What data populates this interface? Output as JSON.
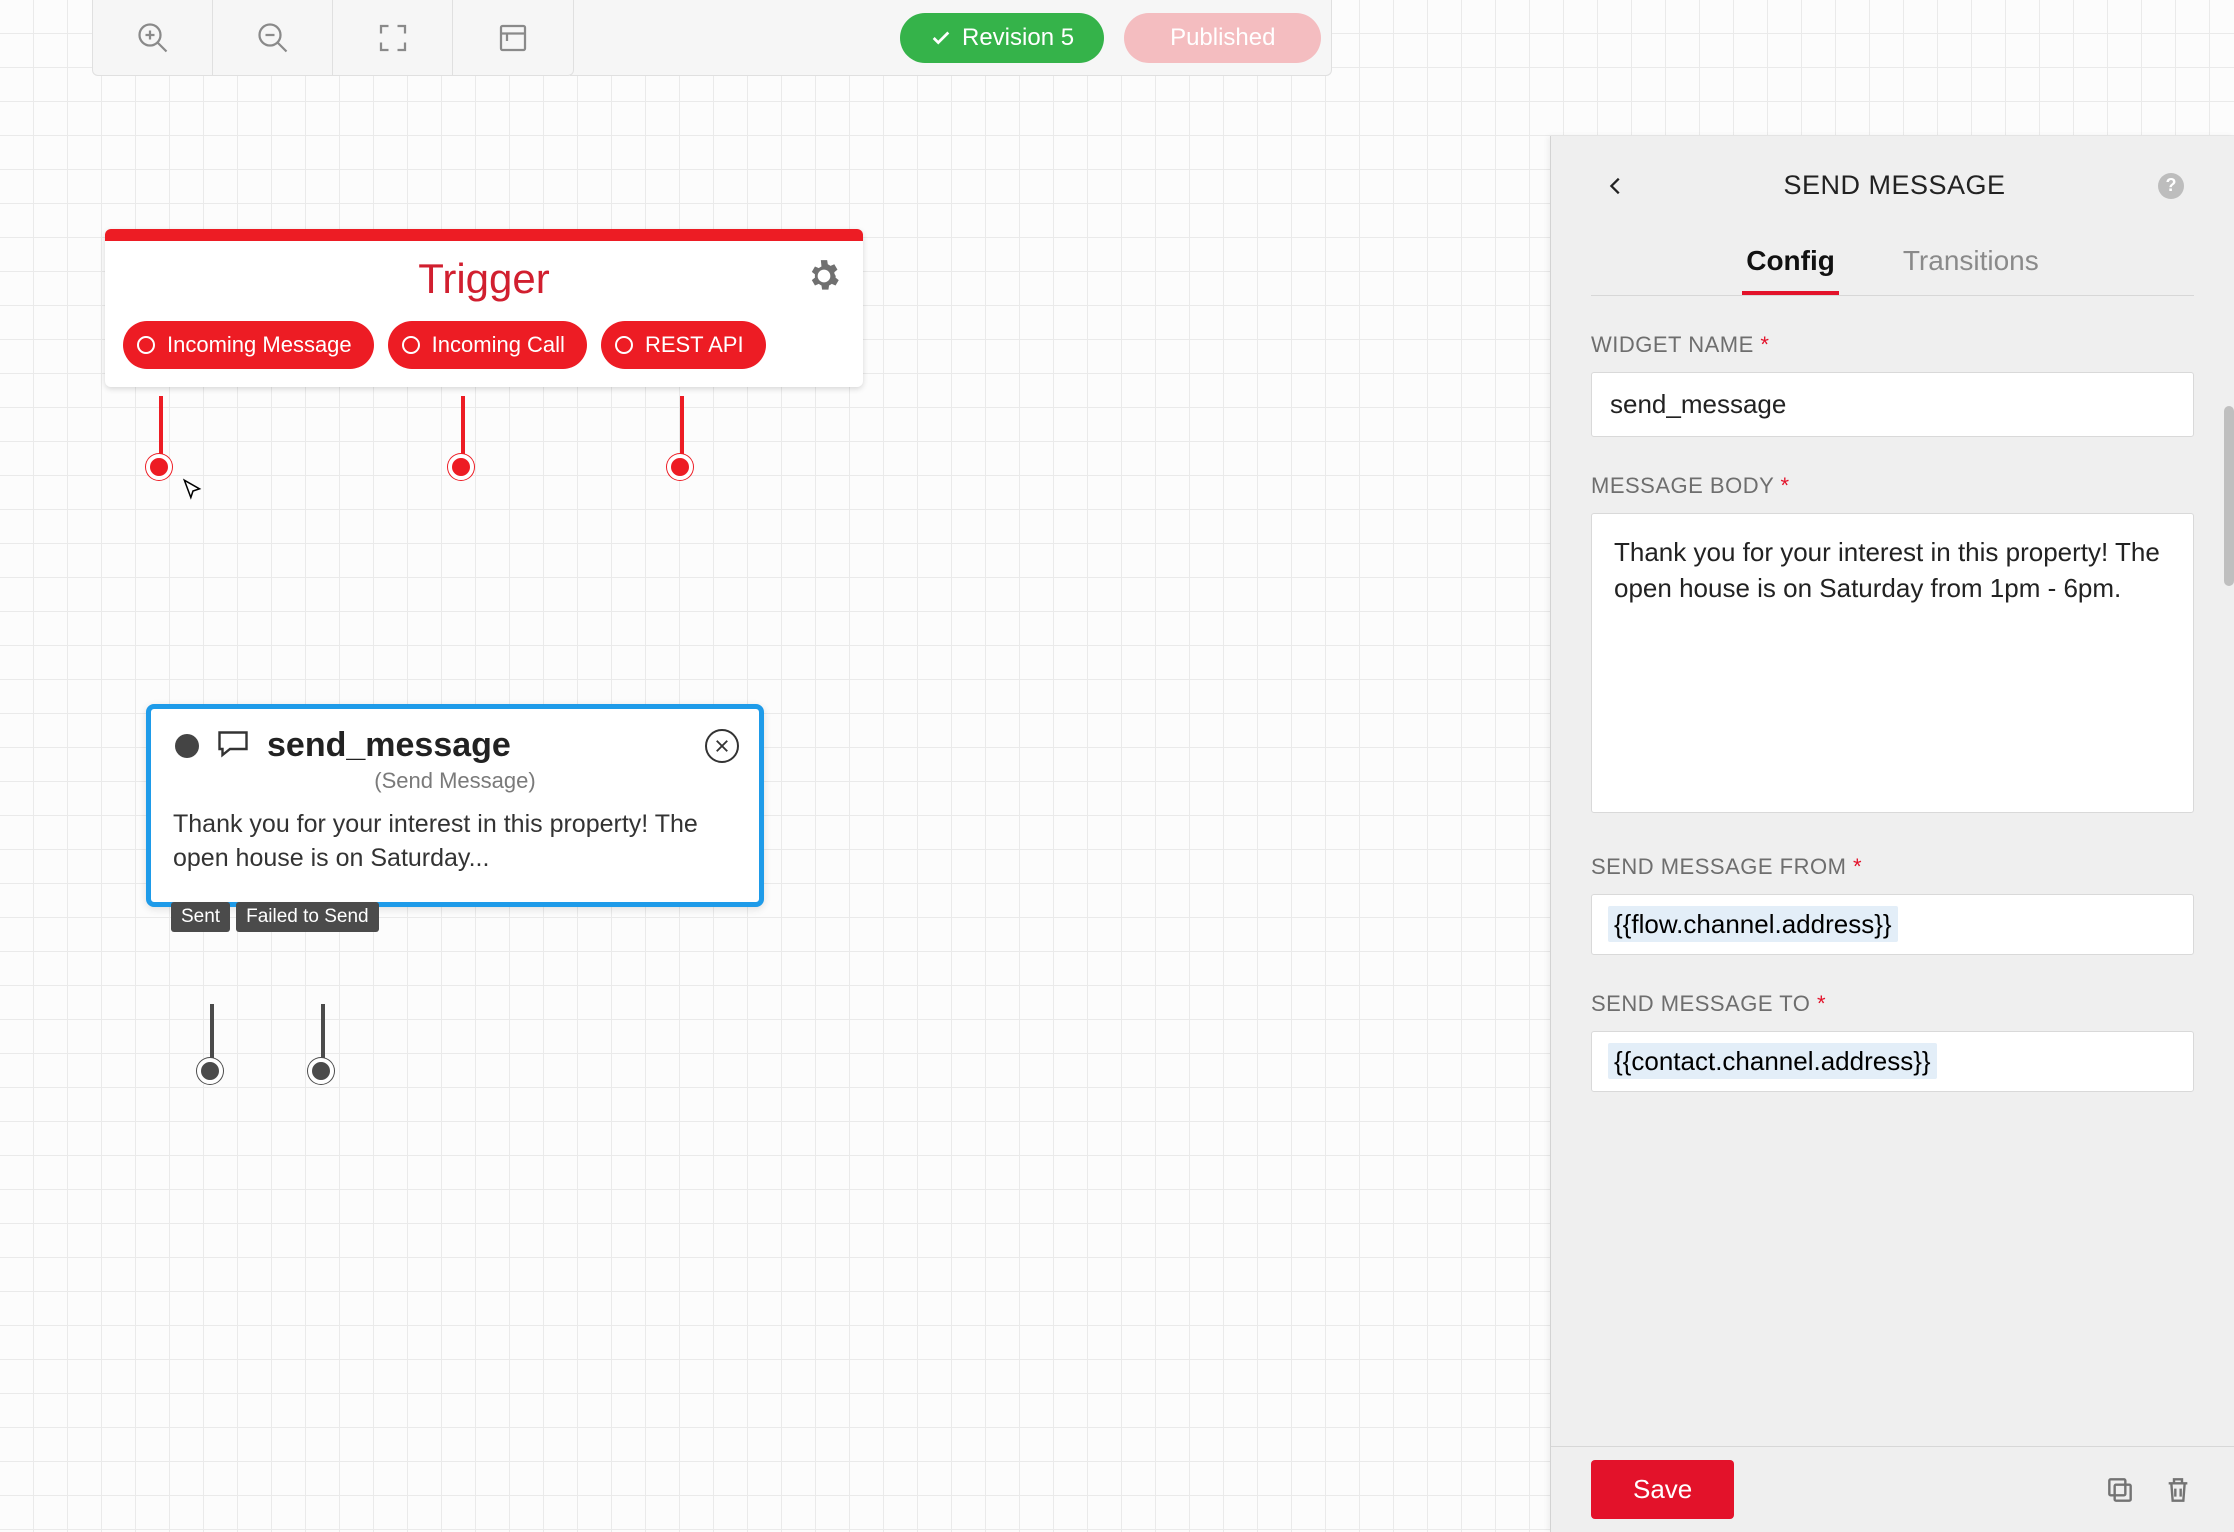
{
  "toolbar": {
    "revision_label": "Revision 5",
    "published_label": "Published"
  },
  "trigger": {
    "title": "Trigger",
    "pills": [
      "Incoming Message",
      "Incoming Call",
      "REST API"
    ]
  },
  "send_message_node": {
    "name": "send_message",
    "subtitle": "(Send Message)",
    "preview": "Thank you for your interest in this property! The open house is on Saturday...",
    "transitions": [
      "Sent",
      "Failed to Send"
    ]
  },
  "panel": {
    "title": "SEND MESSAGE",
    "tabs": {
      "config": "Config",
      "transitions": "Transitions"
    },
    "labels": {
      "widget_name": "WIDGET NAME",
      "message_body": "MESSAGE BODY",
      "send_from": "SEND MESSAGE FROM",
      "send_to": "SEND MESSAGE TO"
    },
    "fields": {
      "widget_name": "send_message",
      "message_body": "Thank you for your interest in this property! The open house is on Saturday from 1pm - 6pm.",
      "send_from": "{{flow.channel.address}}",
      "send_to": "{{contact.channel.address}}"
    },
    "save_label": "Save"
  }
}
